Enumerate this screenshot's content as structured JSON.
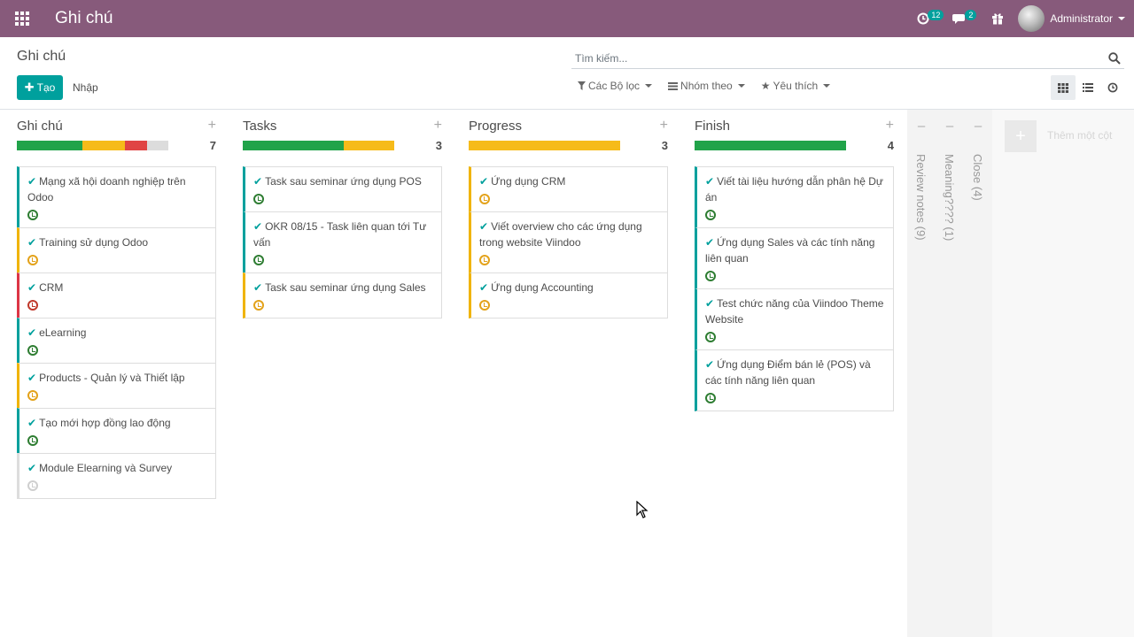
{
  "navbar": {
    "app_title": "Ghi chú",
    "activity_badge": "12",
    "messages_badge": "2",
    "user_name": "Administrator"
  },
  "control_panel": {
    "breadcrumb": "Ghi chú",
    "search_placeholder": "Tìm kiếm...",
    "create_label": "Tạo",
    "import_label": "Nhập",
    "filters_label": "Các Bộ lọc",
    "groupby_label": "Nhóm theo",
    "favorites_label": "Yêu thích"
  },
  "colors": {
    "brand": "#875a7b",
    "accent": "#00a09d",
    "green": "#28a745",
    "yellow": "#f0b400",
    "red": "#dc3545",
    "grey": "#dee2e6"
  },
  "columns": [
    {
      "title": "Ghi chú",
      "count": "7",
      "progress": [
        {
          "color": "#21a34a",
          "fraction": 0.43
        },
        {
          "color": "#f6bb1a",
          "fraction": 0.285
        },
        {
          "color": "#e04444",
          "fraction": 0.145
        },
        {
          "color": "#dcdcdc",
          "fraction": 0.14
        }
      ],
      "cards": [
        {
          "title": "Mạng xã hội doanh nghiệp trên Odoo",
          "status": "green"
        },
        {
          "title": "Training sử dụng Odoo",
          "status": "yellow"
        },
        {
          "title": "CRM",
          "status": "red"
        },
        {
          "title": "eLearning",
          "status": "green"
        },
        {
          "title": "Products - Quản lý và Thiết lập",
          "status": "yellow"
        },
        {
          "title": "Tạo mới hợp đồng lao động",
          "status": "green"
        },
        {
          "title": "Module Elearning và Survey",
          "status": "none"
        }
      ]
    },
    {
      "title": "Tasks",
      "count": "3",
      "progress": [
        {
          "color": "#21a34a",
          "fraction": 0.667
        },
        {
          "color": "#f6bb1a",
          "fraction": 0.333
        }
      ],
      "cards": [
        {
          "title": "Task sau seminar ứng dụng POS",
          "status": "green"
        },
        {
          "title": "OKR 08/15 - Task liên quan tới Tư vấn",
          "status": "green"
        },
        {
          "title": "Task sau seminar ứng dụng Sales",
          "status": "yellow"
        }
      ]
    },
    {
      "title": "Progress",
      "count": "3",
      "progress": [
        {
          "color": "#f6bb1a",
          "fraction": 1.0
        }
      ],
      "cards": [
        {
          "title": "Ứng dụng CRM",
          "status": "yellow"
        },
        {
          "title": "Viết overview cho các ứng dụng trong website Viindoo",
          "status": "yellow"
        },
        {
          "title": "Ứng dụng Accounting",
          "status": "yellow"
        }
      ]
    },
    {
      "title": "Finish",
      "count": "4",
      "progress": [
        {
          "color": "#21a34a",
          "fraction": 1.0
        }
      ],
      "cards": [
        {
          "title": "Viết tài liệu hướng dẫn phân hệ Dự án",
          "status": "green"
        },
        {
          "title": "Ứng dụng Sales và các tính năng liên quan",
          "status": "green"
        },
        {
          "title": "Test chức năng của Viindoo Theme Website",
          "status": "green"
        },
        {
          "title": "Ứng dụng Điểm bán lẻ (POS) và các tính năng liên quan",
          "status": "green"
        }
      ]
    }
  ],
  "folded_columns": [
    {
      "label": "Review notes (9)"
    },
    {
      "label": "Meaning???? (1)"
    },
    {
      "label": "Close (4)"
    }
  ],
  "add_column_label": "Thêm một cột"
}
